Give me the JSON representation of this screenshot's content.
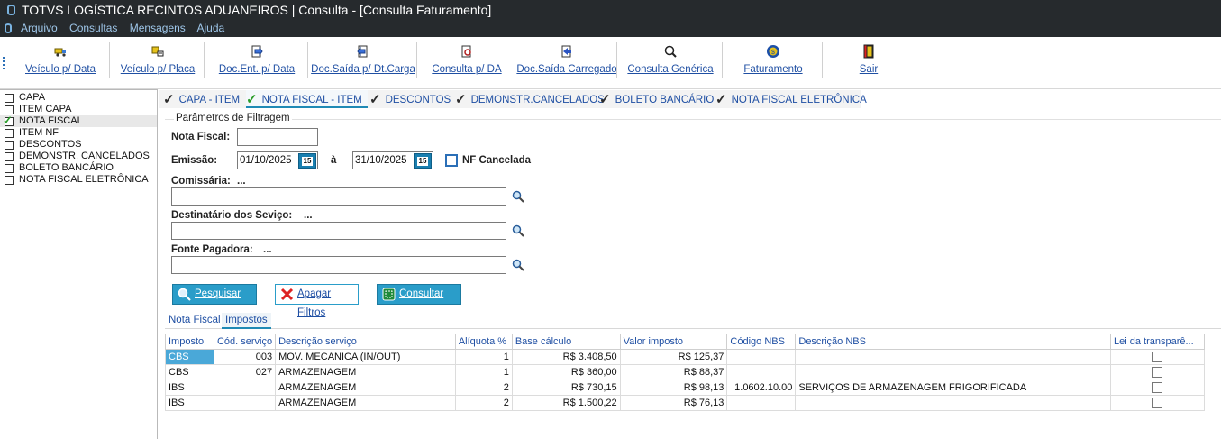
{
  "window": {
    "title": "TOTVS LOGÍSTICA RECINTOS ADUANEIROS | Consulta - [Consulta Faturamento]"
  },
  "menu": [
    "Arquivo",
    "Consultas",
    "Mensagens",
    "Ajuda"
  ],
  "toolbar": {
    "items": [
      {
        "label": "Veículo p/ Data",
        "icon": "truck-icon"
      },
      {
        "label": "Veículo p/ Placa",
        "icon": "truck-plate-icon"
      },
      {
        "label": "Doc.Ent. p/ Data",
        "icon": "doc-entry-icon"
      },
      {
        "label": "Doc.Saída p/ Dt.Carga",
        "icon": "doc-exit-icon"
      },
      {
        "label": "Consulta p/ DA",
        "icon": "query-da-icon"
      },
      {
        "label": "Doc.Saída Carregado",
        "icon": "doc-loaded-icon"
      },
      {
        "label": "Consulta Genérica",
        "icon": "generic-query-icon"
      },
      {
        "label": "Faturamento",
        "icon": "billing-icon"
      },
      {
        "label": "Sair",
        "icon": "exit-door-icon"
      }
    ]
  },
  "sidebar": {
    "items": [
      {
        "label": "CAPA",
        "checked": false
      },
      {
        "label": "ITEM CAPA",
        "checked": false
      },
      {
        "label": "NOTA FISCAL",
        "checked": true
      },
      {
        "label": "ITEM NF",
        "checked": false
      },
      {
        "label": "DESCONTOS",
        "checked": false
      },
      {
        "label": "DEMONSTR. CANCELADOS",
        "checked": false
      },
      {
        "label": "BOLETO BANCÁRIO",
        "checked": false
      },
      {
        "label": "NOTA FISCAL ELETRÔNICA",
        "checked": false
      }
    ]
  },
  "tabs": [
    "CAPA - ITEM",
    "NOTA FISCAL - ITEM",
    "DESCONTOS",
    "DEMONSTR.CANCELADOS",
    "BOLETO BANCÁRIO",
    "NOTA FISCAL ELETRÔNICA"
  ],
  "filters": {
    "group_title": "Parâmetros de Filtragem",
    "nota_fiscal_label": "Nota Fiscal:",
    "nota_fiscal_value": "",
    "emissao_label": "Emissão:",
    "emissao_from": "01/10/2025",
    "emissao_sep": "à",
    "emissao_to": "31/10/2025",
    "calendar_glyph": "15",
    "nf_cancelada_label": "NF Cancelada",
    "comissaria_label": "Comissária:",
    "destinatario_label": "Destinatário dos Seviço:",
    "fonte_label": "Fonte Pagadora:",
    "ellipsis": "..."
  },
  "actions": {
    "pesquisar": "Pesquisar",
    "apagar": "Apagar Filtros",
    "consultar": "Consultar"
  },
  "subtabs": [
    "Nota Fiscal",
    "Impostos"
  ],
  "grid": {
    "columns": [
      "Imposto",
      "Cód. serviço",
      "Descrição serviço",
      "Alíquota %",
      "Base cálculo",
      "Valor imposto",
      "Código NBS",
      "Descrição NBS",
      "Lei da transparê..."
    ],
    "rows": [
      [
        "CBS",
        "003",
        "MOV. MECANICA (IN/OUT)",
        "1",
        "R$ 3.408,50",
        "R$ 125,37",
        "",
        ""
      ],
      [
        "CBS",
        "027",
        "ARMAZENAGEM",
        "1",
        "R$ 360,00",
        "R$ 88,37",
        "",
        ""
      ],
      [
        "IBS",
        "",
        "ARMAZENAGEM",
        "2",
        "R$ 730,15",
        "R$ 98,13",
        "1.0602.10.00",
        "SERVIÇOS DE ARMAZENAGEM FRIGORIFICADA"
      ],
      [
        "IBS",
        "",
        "ARMAZENAGEM",
        "2",
        "R$ 1.500,22",
        "R$ 76,13",
        "",
        ""
      ]
    ]
  }
}
